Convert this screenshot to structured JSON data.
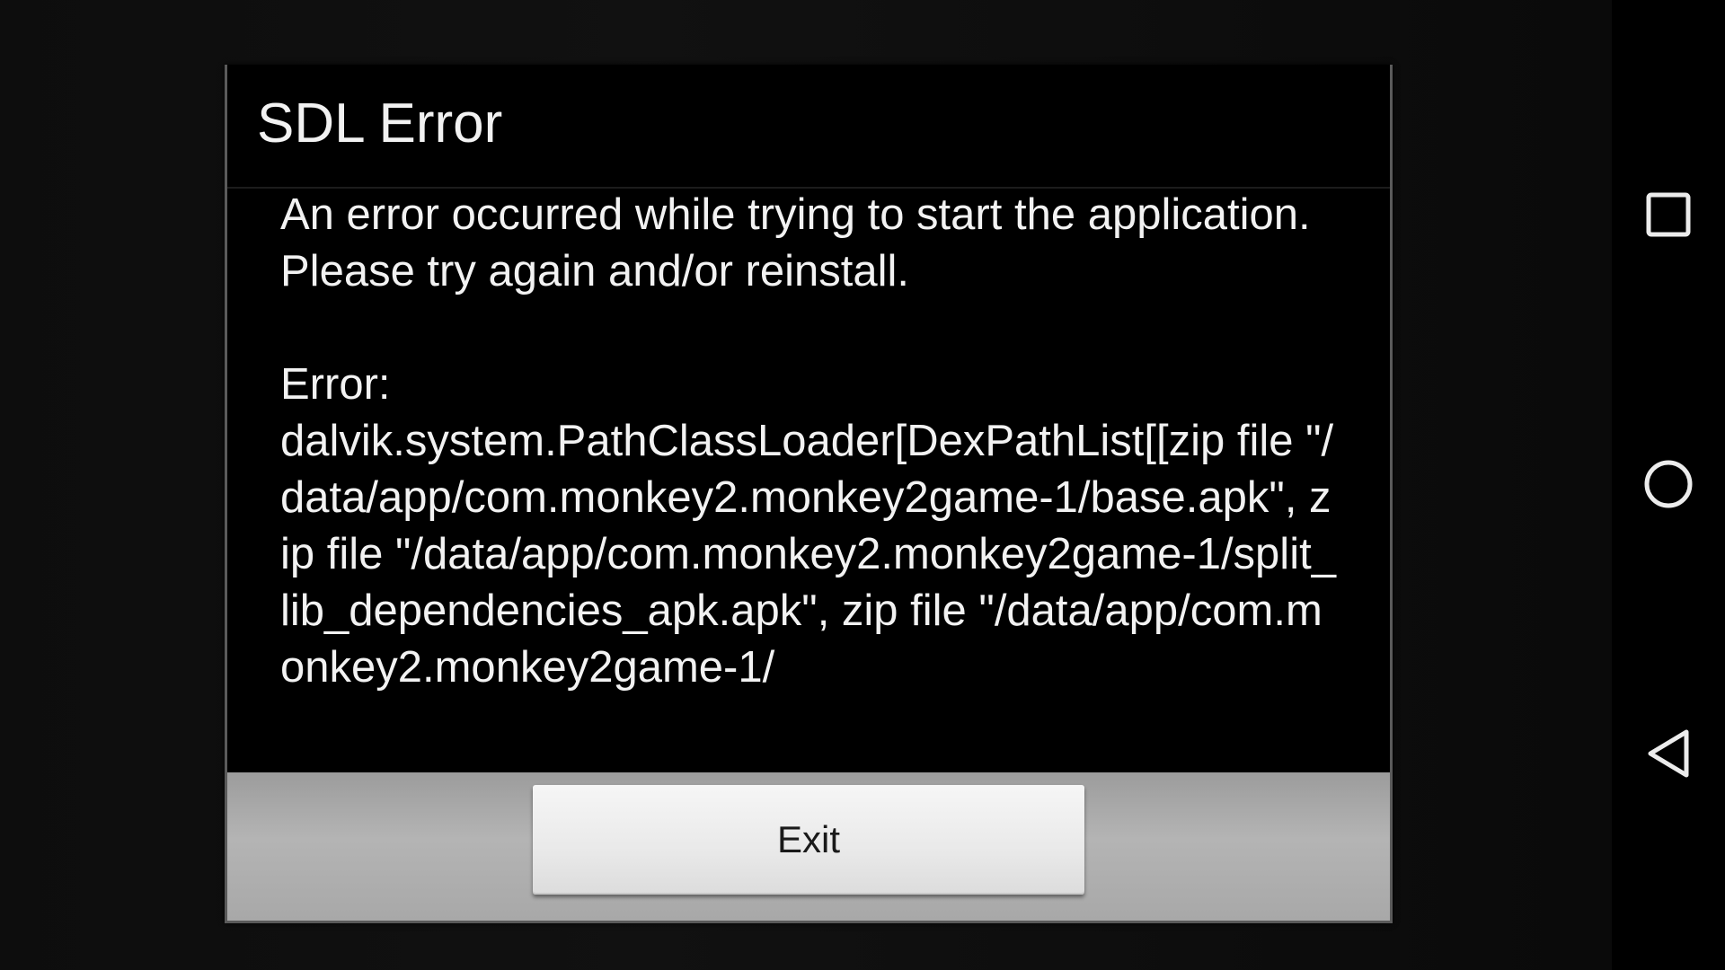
{
  "dialog": {
    "title": "SDL Error",
    "message": "An error occurred while trying to start the application. Please try again and/or reinstall.\n\nError:\ndalvik.system.PathClassLoader[DexPathList[[zip file \"/data/app/com.monkey2.monkey2game-1/base.apk\", zip file \"/data/app/com.monkey2.monkey2game-1/split_lib_dependencies_apk.apk\", zip file \"/data/app/com.monkey2.monkey2game-1/",
    "exit_label": "Exit"
  },
  "navbar": {
    "recents_icon": "square-icon",
    "home_icon": "circle-icon",
    "back_icon": "triangle-back-icon"
  },
  "colors": {
    "dialog_background": "#000000",
    "text": "#f2f2f2",
    "button_bar": "#b0b0b0",
    "button_face": "#e9e9e9"
  }
}
